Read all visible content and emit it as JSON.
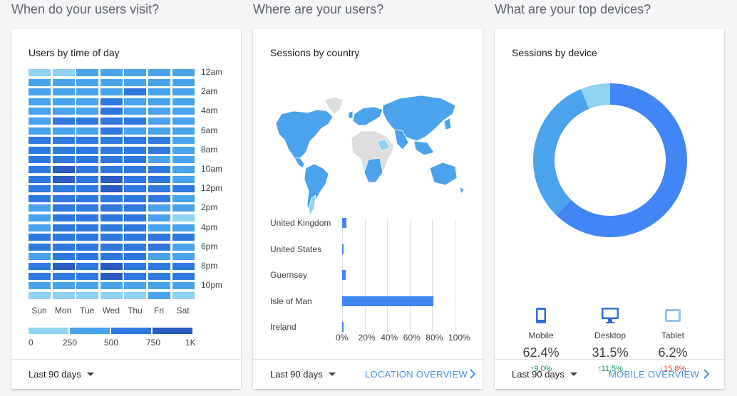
{
  "sections": {
    "visit_title": "When do your users visit?",
    "where_title": "Where are your users?",
    "devices_title": "What are your top devices?"
  },
  "time_card": {
    "title": "Users by time of day",
    "footer_range": "Last 90 days",
    "chart_data": {
      "type": "heatmap",
      "days": [
        "Sun",
        "Mon",
        "Tue",
        "Wed",
        "Thu",
        "Fri",
        "Sat"
      ],
      "hour_labels": [
        "12am",
        "2am",
        "4am",
        "6am",
        "8am",
        "10am",
        "12pm",
        "2pm",
        "4pm",
        "6pm",
        "8pm",
        "10pm"
      ],
      "rows": 24,
      "levels": [
        [
          0,
          0,
          1,
          1,
          1,
          1,
          1
        ],
        [
          1,
          1,
          1,
          1,
          1,
          1,
          1
        ],
        [
          1,
          1,
          1,
          1,
          2,
          1,
          1
        ],
        [
          1,
          1,
          1,
          2,
          1,
          1,
          1
        ],
        [
          1,
          1,
          1,
          2,
          1,
          1,
          1
        ],
        [
          1,
          2,
          2,
          2,
          2,
          1,
          1
        ],
        [
          1,
          1,
          1,
          2,
          1,
          1,
          1
        ],
        [
          2,
          2,
          2,
          2,
          2,
          2,
          1
        ],
        [
          2,
          2,
          2,
          2,
          2,
          2,
          1
        ],
        [
          2,
          2,
          2,
          2,
          2,
          1,
          1
        ],
        [
          2,
          3,
          2,
          2,
          2,
          2,
          1
        ],
        [
          2,
          3,
          2,
          3,
          2,
          2,
          1
        ],
        [
          2,
          2,
          2,
          3,
          2,
          2,
          2
        ],
        [
          2,
          2,
          2,
          2,
          2,
          2,
          1
        ],
        [
          1,
          2,
          2,
          2,
          2,
          1,
          1
        ],
        [
          1,
          2,
          2,
          2,
          2,
          1,
          0
        ],
        [
          1,
          2,
          2,
          2,
          2,
          1,
          1
        ],
        [
          2,
          2,
          2,
          2,
          2,
          2,
          2
        ],
        [
          2,
          2,
          2,
          2,
          2,
          2,
          1
        ],
        [
          1,
          2,
          2,
          2,
          2,
          1,
          1
        ],
        [
          2,
          3,
          2,
          3,
          2,
          2,
          2
        ],
        [
          2,
          2,
          2,
          3,
          2,
          2,
          2
        ],
        [
          1,
          1,
          1,
          1,
          1,
          1,
          1
        ],
        [
          0,
          0,
          0,
          0,
          0,
          1,
          0
        ]
      ],
      "colors": [
        "#8fd3f0",
        "#49a3ec",
        "#2e78e0",
        "#2b5bc2"
      ],
      "legend_ticks": [
        "0",
        "250",
        "500",
        "750",
        "1K"
      ]
    }
  },
  "country_card": {
    "title": "Sessions by country",
    "footer_range": "Last 90 days",
    "footer_link": "LOCATION OVERVIEW",
    "chart_data": {
      "type": "bar",
      "categories": [
        "United Kingdom",
        "United States",
        "Guernsey",
        "Isle of Man",
        "Ireland"
      ],
      "values": [
        4,
        1,
        3,
        81,
        1
      ],
      "xlim": [
        0,
        100
      ],
      "x_ticks": [
        "0%",
        "20%",
        "40%",
        "60%",
        "80%",
        "100%"
      ],
      "color": "#4285f4"
    }
  },
  "device_card": {
    "title": "Sessions by device",
    "footer_range": "Last 90 days",
    "footer_link": "MOBILE OVERVIEW",
    "chart_data": {
      "type": "pie",
      "categories": [
        "Mobile",
        "Desktop",
        "Tablet"
      ],
      "values": [
        62.4,
        31.5,
        6.2
      ],
      "colors": [
        "#4285f4",
        "#4aa3ec",
        "#8fd3f0"
      ]
    },
    "devices": [
      {
        "name": "Mobile",
        "value": "62.4%",
        "change": "9.0%",
        "arrow": "↑"
      },
      {
        "name": "Desktop",
        "value": "31.5%",
        "change": "11.5%",
        "arrow": "↑"
      },
      {
        "name": "Tablet",
        "value": "6.2%",
        "change": "15.8%",
        "arrow": "↓"
      }
    ]
  }
}
